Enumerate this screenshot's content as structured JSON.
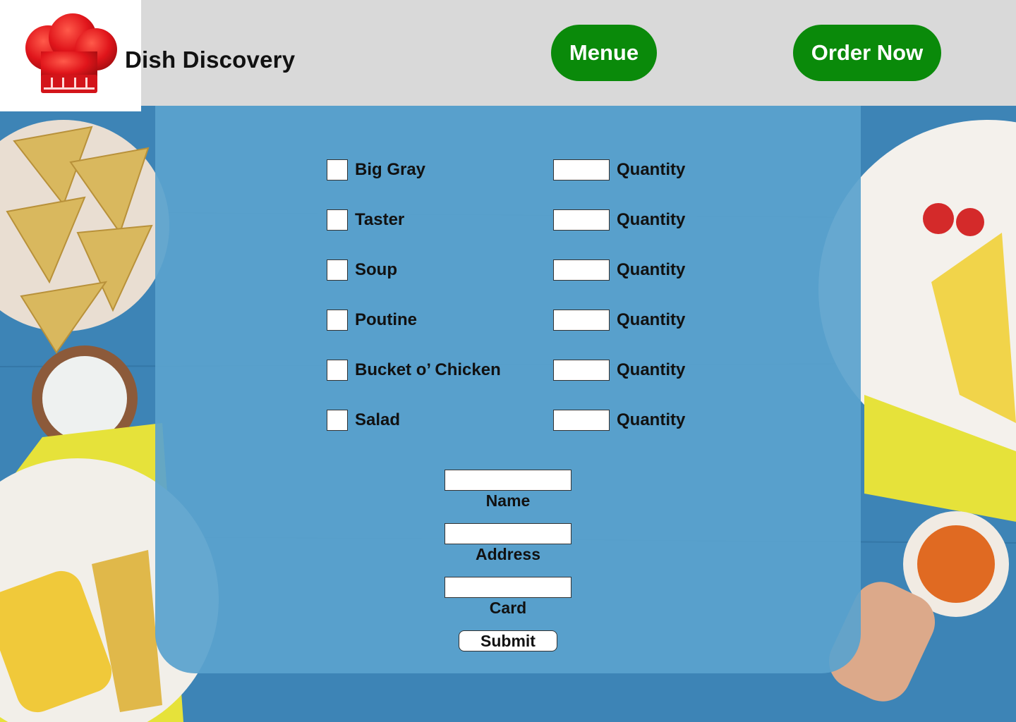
{
  "header": {
    "brand": "Dish Discovery",
    "logo_icon": "chef-hat-icon",
    "nav": {
      "menu_label": "Menue",
      "order_label": "Order Now"
    }
  },
  "order_form": {
    "items": [
      {
        "name": "Big Gray",
        "qty_label": "Quantity"
      },
      {
        "name": "Taster",
        "qty_label": "Quantity"
      },
      {
        "name": "Soup",
        "qty_label": "Quantity"
      },
      {
        "name": "Poutine",
        "qty_label": "Quantity"
      },
      {
        "name": "Bucket o’ Chicken",
        "qty_label": "Quantity"
      },
      {
        "name": "Salad",
        "qty_label": "Quantity"
      }
    ],
    "fields": {
      "name_label": "Name",
      "address_label": "Address",
      "card_label": "Card"
    },
    "submit_label": "Submit"
  },
  "colors": {
    "header_bg": "#d9d9d9",
    "nav_button": "#0a8a0a",
    "panel": "#5aa2ce",
    "logo_red": "#e0151b"
  }
}
